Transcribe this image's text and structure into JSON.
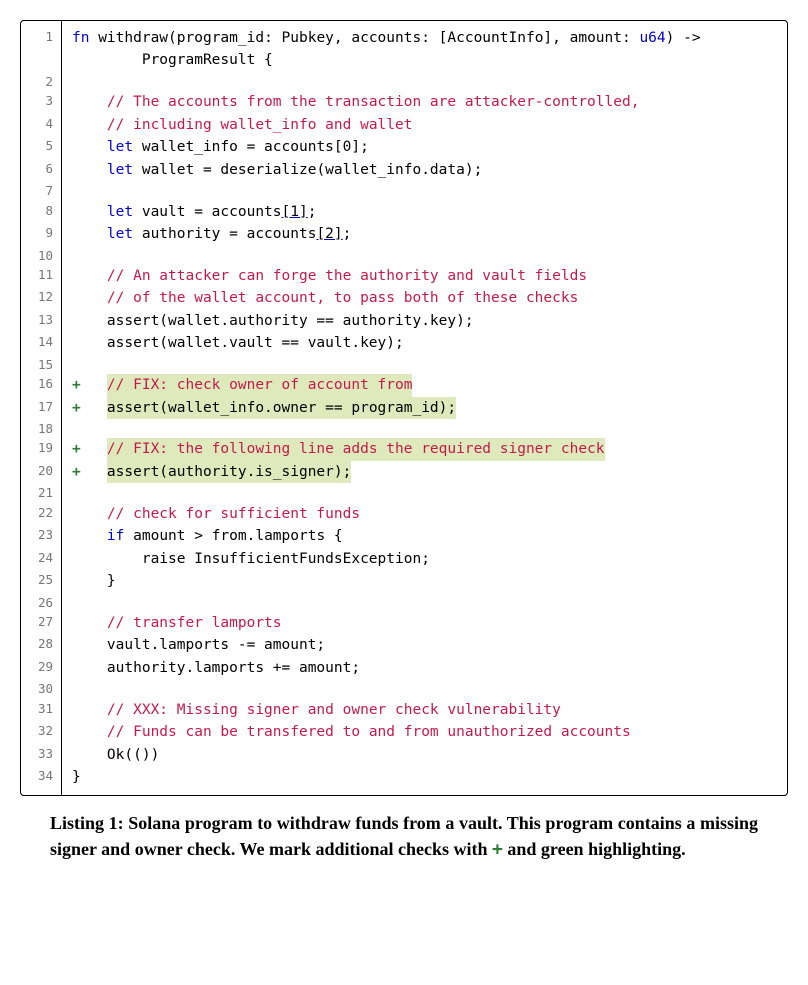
{
  "listing": {
    "number": "1",
    "caption_prefix": "Listing 1: ",
    "caption_body_a": "Solana program to withdraw funds from a vault. This program contains a missing signer and owner check. We mark additional checks with ",
    "caption_plus": "+",
    "caption_body_b": " and green highlighting."
  },
  "code_lines": [
    {
      "n": 1,
      "plus": false,
      "hl": false,
      "segments": [
        {
          "t": "fn ",
          "c": "kw"
        },
        {
          "t": "withdraw(program_id: Pubkey, accounts: [AccountInfo], amount: "
        },
        {
          "t": "u64",
          "c": "ty"
        },
        {
          "t": ") ->"
        }
      ],
      "cont_segments": [
        {
          "t": "ProgramResult {"
        }
      ]
    },
    {
      "n": 2,
      "plus": false,
      "hl": false,
      "segments": [
        {
          "t": ""
        }
      ]
    },
    {
      "n": 3,
      "plus": false,
      "hl": false,
      "segments": [
        {
          "t": "    "
        },
        {
          "t": "// The accounts from the transaction are attacker-controlled,",
          "c": "cm"
        }
      ]
    },
    {
      "n": 4,
      "plus": false,
      "hl": false,
      "segments": [
        {
          "t": "    "
        },
        {
          "t": "// including wallet_info and wallet",
          "c": "cm"
        }
      ]
    },
    {
      "n": 5,
      "plus": false,
      "hl": false,
      "segments": [
        {
          "t": "    "
        },
        {
          "t": "let ",
          "c": "kw"
        },
        {
          "t": "wallet_info = accounts[0];"
        }
      ]
    },
    {
      "n": 6,
      "plus": false,
      "hl": false,
      "segments": [
        {
          "t": "    "
        },
        {
          "t": "let ",
          "c": "kw"
        },
        {
          "t": "wallet = deserialize(wallet_info.data);"
        }
      ]
    },
    {
      "n": 7,
      "plus": false,
      "hl": false,
      "segments": [
        {
          "t": ""
        }
      ]
    },
    {
      "n": 8,
      "plus": false,
      "hl": false,
      "segments": [
        {
          "t": "    "
        },
        {
          "t": "let ",
          "c": "kw"
        },
        {
          "t": "vault = accounts"
        },
        {
          "t": "[1]",
          "c": "ul"
        },
        {
          "t": ";"
        }
      ]
    },
    {
      "n": 9,
      "plus": false,
      "hl": false,
      "segments": [
        {
          "t": "    "
        },
        {
          "t": "let ",
          "c": "kw"
        },
        {
          "t": "authority = accounts"
        },
        {
          "t": "[2]",
          "c": "ul"
        },
        {
          "t": ";"
        }
      ]
    },
    {
      "n": 10,
      "plus": false,
      "hl": false,
      "segments": [
        {
          "t": ""
        }
      ]
    },
    {
      "n": 11,
      "plus": false,
      "hl": false,
      "segments": [
        {
          "t": "    "
        },
        {
          "t": "// An attacker can forge the authority and vault fields",
          "c": "cm"
        }
      ]
    },
    {
      "n": 12,
      "plus": false,
      "hl": false,
      "segments": [
        {
          "t": "    "
        },
        {
          "t": "// of the wallet account, to pass both of these checks",
          "c": "cm"
        }
      ]
    },
    {
      "n": 13,
      "plus": false,
      "hl": false,
      "segments": [
        {
          "t": "    assert(wallet.authority == authority.key);"
        }
      ]
    },
    {
      "n": 14,
      "plus": false,
      "hl": false,
      "segments": [
        {
          "t": "    assert(wallet.vault == vault.key);"
        }
      ]
    },
    {
      "n": 15,
      "plus": false,
      "hl": false,
      "segments": [
        {
          "t": ""
        }
      ]
    },
    {
      "n": 16,
      "plus": true,
      "hl": true,
      "segments": [
        {
          "t": "// FIX: check owner of account from",
          "c": "cm"
        }
      ]
    },
    {
      "n": 17,
      "plus": true,
      "hl": true,
      "segments": [
        {
          "t": "assert(wallet_info.owner == program_id);"
        }
      ]
    },
    {
      "n": 18,
      "plus": false,
      "hl": false,
      "segments": [
        {
          "t": ""
        }
      ]
    },
    {
      "n": 19,
      "plus": true,
      "hl": true,
      "segments": [
        {
          "t": "// FIX: the following line adds the required signer check",
          "c": "cm"
        }
      ]
    },
    {
      "n": 20,
      "plus": true,
      "hl": true,
      "segments": [
        {
          "t": "assert(authority.is_signer);"
        }
      ]
    },
    {
      "n": 21,
      "plus": false,
      "hl": false,
      "segments": [
        {
          "t": ""
        }
      ]
    },
    {
      "n": 22,
      "plus": false,
      "hl": false,
      "segments": [
        {
          "t": "    "
        },
        {
          "t": "// check for sufficient funds",
          "c": "cm"
        }
      ]
    },
    {
      "n": 23,
      "plus": false,
      "hl": false,
      "segments": [
        {
          "t": "    "
        },
        {
          "t": "if ",
          "c": "kw"
        },
        {
          "t": "amount > from.lamports {"
        }
      ]
    },
    {
      "n": 24,
      "plus": false,
      "hl": false,
      "segments": [
        {
          "t": "        raise InsufficientFundsException;"
        }
      ]
    },
    {
      "n": 25,
      "plus": false,
      "hl": false,
      "segments": [
        {
          "t": "    }"
        }
      ]
    },
    {
      "n": 26,
      "plus": false,
      "hl": false,
      "segments": [
        {
          "t": ""
        }
      ]
    },
    {
      "n": 27,
      "plus": false,
      "hl": false,
      "segments": [
        {
          "t": "    "
        },
        {
          "t": "// transfer lamports",
          "c": "cm"
        }
      ]
    },
    {
      "n": 28,
      "plus": false,
      "hl": false,
      "segments": [
        {
          "t": "    vault.lamports -= amount;"
        }
      ]
    },
    {
      "n": 29,
      "plus": false,
      "hl": false,
      "segments": [
        {
          "t": "    authority.lamports += amount;"
        }
      ]
    },
    {
      "n": 30,
      "plus": false,
      "hl": false,
      "segments": [
        {
          "t": ""
        }
      ]
    },
    {
      "n": 31,
      "plus": false,
      "hl": false,
      "segments": [
        {
          "t": "    "
        },
        {
          "t": "// XXX: Missing signer and owner check vulnerability",
          "c": "cm"
        }
      ]
    },
    {
      "n": 32,
      "plus": false,
      "hl": false,
      "segments": [
        {
          "t": "    "
        },
        {
          "t": "// Funds can be transfered to and from unauthorized accounts",
          "c": "cm"
        }
      ]
    },
    {
      "n": 33,
      "plus": false,
      "hl": false,
      "segments": [
        {
          "t": "    Ok(())"
        }
      ]
    },
    {
      "n": 34,
      "plus": false,
      "hl": false,
      "segments": [
        {
          "t": "}"
        }
      ]
    }
  ]
}
